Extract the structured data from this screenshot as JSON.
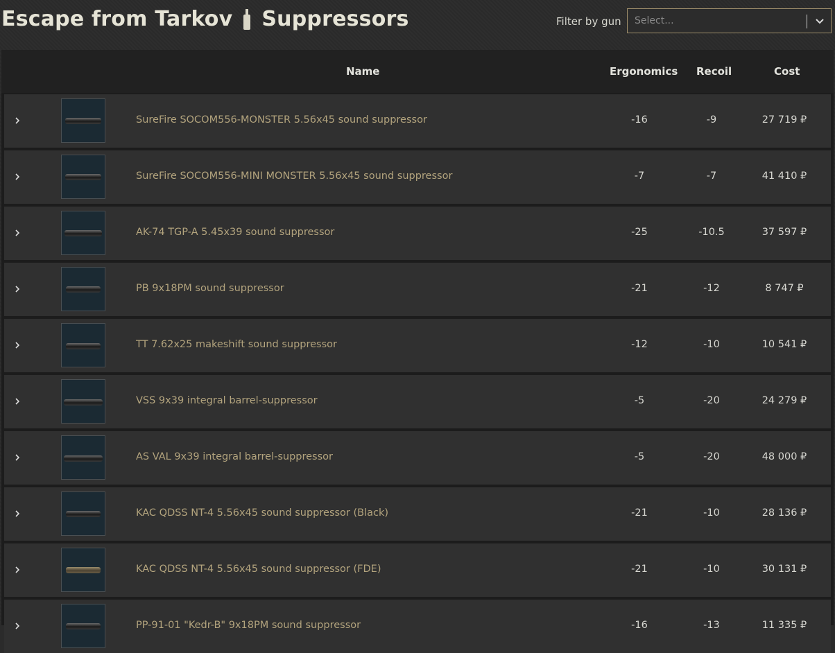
{
  "header": {
    "title_left": "Escape from Tarkov",
    "title_right": "Suppressors",
    "separator_icon": "suppressor-icon"
  },
  "filter": {
    "label": "Filter by gun",
    "placeholder": "Select...",
    "dropdown_icon": "chevron-down-icon"
  },
  "table": {
    "columns": [
      "Name",
      "Ergonomics",
      "Recoil",
      "Cost"
    ],
    "rows": [
      {
        "name": "SureFire SOCOM556-MONSTER 5.56x45 sound suppressor",
        "ergonomics": "-16",
        "recoil": "-9",
        "cost": "27 719 ₽"
      },
      {
        "name": "SureFire SOCOM556-MINI MONSTER 5.56x45 sound suppressor",
        "ergonomics": "-7",
        "recoil": "-7",
        "cost": "41 410 ₽"
      },
      {
        "name": "AK-74 TGP-A 5.45x39 sound suppressor",
        "ergonomics": "-25",
        "recoil": "-10.5",
        "cost": "37 597 ₽"
      },
      {
        "name": "PB 9x18PM sound suppressor",
        "ergonomics": "-21",
        "recoil": "-12",
        "cost": "8 747 ₽"
      },
      {
        "name": "TT 7.62x25 makeshift sound suppressor",
        "ergonomics": "-12",
        "recoil": "-10",
        "cost": "10 541 ₽"
      },
      {
        "name": "VSS 9x39 integral barrel-suppressor",
        "ergonomics": "-5",
        "recoil": "-20",
        "cost": "24 279 ₽"
      },
      {
        "name": "AS VAL 9x39 integral barrel-suppressor",
        "ergonomics": "-5",
        "recoil": "-20",
        "cost": "48 000 ₽"
      },
      {
        "name": "KAC QDSS NT-4 5.56x45 sound suppressor (Black)",
        "ergonomics": "-21",
        "recoil": "-10",
        "cost": "28 136 ₽"
      },
      {
        "name": "KAC QDSS NT-4 5.56x45 sound suppressor (FDE)",
        "ergonomics": "-21",
        "recoil": "-10",
        "cost": "30 131 ₽"
      },
      {
        "name": "PP-91-01 \"Kedr-B\" 9x18PM sound suppressor",
        "ergonomics": "-16",
        "recoil": "-13",
        "cost": "11 335 ₽"
      }
    ]
  },
  "colors": {
    "accent_border": "#a08f6b",
    "item_name": "#b2a37d",
    "thumb_bg": "#1b2a33"
  }
}
